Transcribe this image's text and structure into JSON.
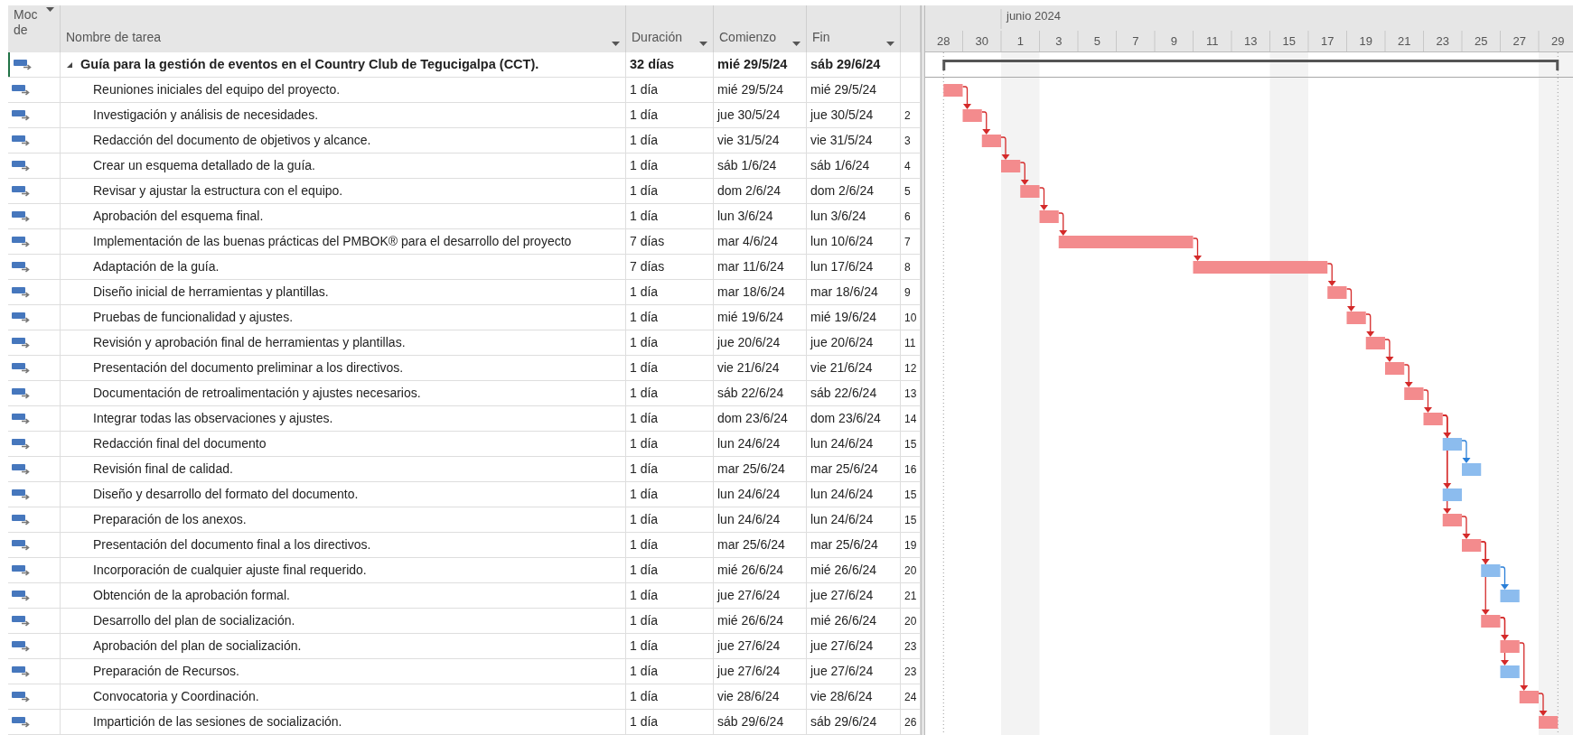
{
  "headers": [
    "Moc de",
    "Nombre de tarea",
    "Duración",
    "Comienzo",
    "Fin"
  ],
  "timeline": {
    "month": "junio 2024",
    "days": [
      "28",
      "30",
      "1",
      "3",
      "5",
      "7",
      "9",
      "11",
      "13",
      "15",
      "17",
      "19",
      "21",
      "23",
      "25",
      "27",
      "29"
    ]
  },
  "summary": {
    "name": "Guía para la gestión de eventos en el Country Club de Tegucigalpa (CCT).",
    "duration": "32 días",
    "start": "mié 29/5/24",
    "finish": "sáb 29/6/24",
    "expanded": true
  },
  "tasks": [
    {
      "name": "Reuniones iniciales del equipo del proyecto.",
      "duration": "1 día",
      "start": "mié 29/5/24",
      "finish": "mié 29/5/24",
      "critical": true
    },
    {
      "name": "Investigación y análisis de necesidades.",
      "duration": "1 día",
      "start": "jue 30/5/24",
      "finish": "jue 30/5/24",
      "critical": true,
      "predecessors": "2"
    },
    {
      "name": "Redacción del documento de objetivos y alcance.",
      "duration": "1 día",
      "start": "vie 31/5/24",
      "finish": "vie 31/5/24",
      "critical": true,
      "predecessors": "3"
    },
    {
      "name": "Crear un esquema detallado de la guía.",
      "duration": "1 día",
      "start": "sáb 1/6/24",
      "finish": "sáb 1/6/24",
      "critical": true,
      "predecessors": "4"
    },
    {
      "name": "Revisar y ajustar la estructura con el equipo.",
      "duration": "1 día",
      "start": "dom 2/6/24",
      "finish": "dom 2/6/24",
      "critical": true,
      "predecessors": "5"
    },
    {
      "name": "Aprobación del esquema final.",
      "duration": "1 día",
      "start": "lun 3/6/24",
      "finish": "lun 3/6/24",
      "critical": true,
      "predecessors": "6"
    },
    {
      "name": "Implementación de las buenas prácticas del PMBOK® para el desarrollo del proyecto",
      "duration": "7 días",
      "start": "mar 4/6/24",
      "finish": "lun 10/6/24",
      "critical": true,
      "predecessors": "7"
    },
    {
      "name": "Adaptación de la guía.",
      "duration": "7 días",
      "start": "mar 11/6/24",
      "finish": "lun 17/6/24",
      "critical": true,
      "predecessors": "8"
    },
    {
      "name": "Diseño inicial de herramientas y plantillas.",
      "duration": "1 día",
      "start": "mar 18/6/24",
      "finish": "mar 18/6/24",
      "critical": true,
      "predecessors": "9"
    },
    {
      "name": "Pruebas de funcionalidad y ajustes.",
      "duration": "1 día",
      "start": "mié 19/6/24",
      "finish": "mié 19/6/24",
      "critical": true,
      "predecessors": "10"
    },
    {
      "name": "Revisión y aprobación final de herramientas y plantillas.",
      "duration": "1 día",
      "start": "jue 20/6/24",
      "finish": "jue 20/6/24",
      "critical": true,
      "predecessors": "11"
    },
    {
      "name": "Presentación del documento preliminar a los directivos.",
      "duration": "1 día",
      "start": "vie 21/6/24",
      "finish": "vie 21/6/24",
      "critical": true,
      "predecessors": "12"
    },
    {
      "name": "Documentación de retroalimentación y ajustes necesarios.",
      "duration": "1 día",
      "start": "sáb 22/6/24",
      "finish": "sáb 22/6/24",
      "critical": true,
      "predecessors": "13"
    },
    {
      "name": "Integrar todas las observaciones y ajustes.",
      "duration": "1 día",
      "start": "dom 23/6/24",
      "finish": "dom 23/6/24",
      "critical": true,
      "predecessors": "14"
    },
    {
      "name": "Redacción final del documento",
      "duration": "1 día",
      "start": "lun 24/6/24",
      "finish": "lun 24/6/24",
      "critical": false,
      "predecessors": "15"
    },
    {
      "name": "Revisión final de calidad.",
      "duration": "1 día",
      "start": "mar 25/6/24",
      "finish": "mar 25/6/24",
      "critical": false,
      "predecessors": "16"
    },
    {
      "name": "Diseño y desarrollo del formato del documento.",
      "duration": "1 día",
      "start": "lun 24/6/24",
      "finish": "lun 24/6/24",
      "critical": false,
      "predecessors": "15"
    },
    {
      "name": "Preparación de los anexos.",
      "duration": "1 día",
      "start": "lun 24/6/24",
      "finish": "lun 24/6/24",
      "critical": true,
      "predecessors": "15"
    },
    {
      "name": "Presentación del documento final a los directivos.",
      "duration": "1 día",
      "start": "mar 25/6/24",
      "finish": "mar 25/6/24",
      "critical": true,
      "predecessors": "19"
    },
    {
      "name": "Incorporación de cualquier ajuste final requerido.",
      "duration": "1 día",
      "start": "mié 26/6/24",
      "finish": "mié 26/6/24",
      "critical": false,
      "predecessors": "20"
    },
    {
      "name": "Obtención de la aprobación formal.",
      "duration": "1 día",
      "start": "jue 27/6/24",
      "finish": "jue 27/6/24",
      "critical": false,
      "predecessors": "21"
    },
    {
      "name": "Desarrollo del plan de socialización.",
      "duration": "1 día",
      "start": "mié 26/6/24",
      "finish": "mié 26/6/24",
      "critical": true,
      "predecessors": "20"
    },
    {
      "name": "Aprobación del plan de socialización.",
      "duration": "1 día",
      "start": "jue 27/6/24",
      "finish": "jue 27/6/24",
      "critical": true,
      "predecessors": "23"
    },
    {
      "name": "Preparación de Recursos.",
      "duration": "1 día",
      "start": "jue 27/6/24",
      "finish": "jue 27/6/24",
      "critical": false,
      "predecessors": "23"
    },
    {
      "name": "Convocatoria y Coordinación.",
      "duration": "1 día",
      "start": "vie 28/6/24",
      "finish": "vie 28/6/24",
      "critical": true,
      "predecessors": "24"
    },
    {
      "name": "Impartición de las sesiones de socialización.",
      "duration": "1 día",
      "start": "sáb 29/6/24",
      "finish": "sáb 29/6/24",
      "critical": true,
      "predecessors": "26"
    }
  ]
}
